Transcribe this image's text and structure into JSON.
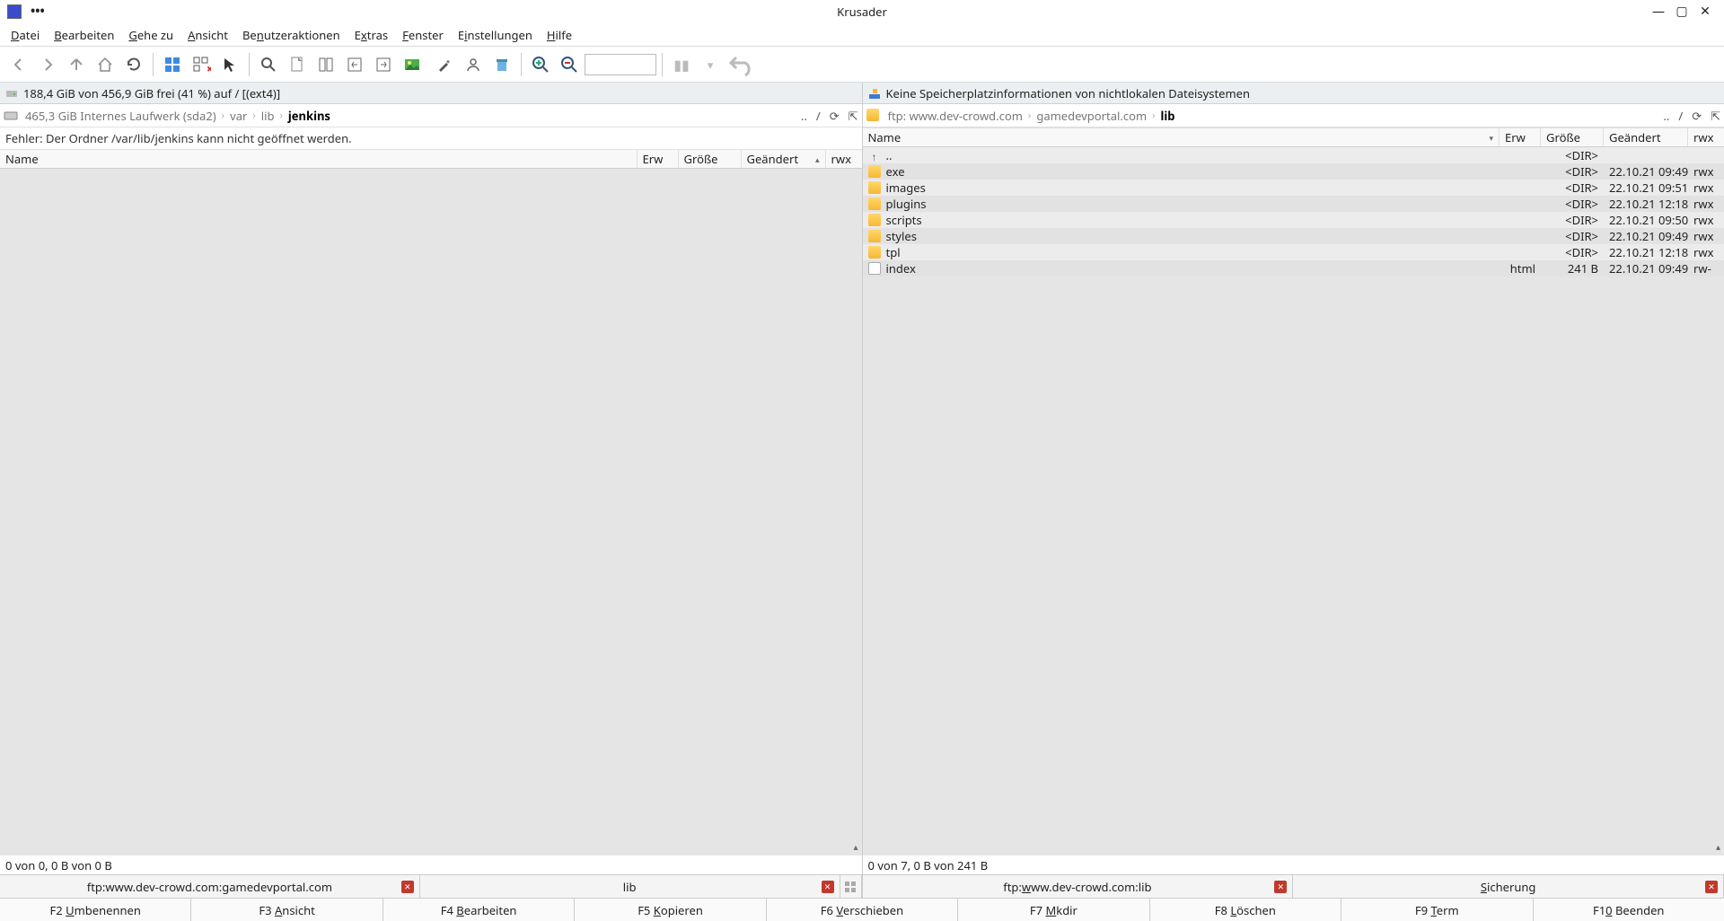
{
  "title": "Krusader",
  "menu": [
    "Datei",
    "Bearbeiten",
    "Gehe zu",
    "Ansicht",
    "Benutzeraktionen",
    "Extras",
    "Fenster",
    "Einstellungen",
    "Hilfe"
  ],
  "menu_ul": [
    0,
    0,
    0,
    0,
    2,
    1,
    0,
    1,
    0
  ],
  "left": {
    "disk": "188,4 GiB von 456,9 GiB frei (41 %) auf / [(ext4)]",
    "bc_prefix": "465,3 GiB Internes Laufwerk (sda2)",
    "bc": [
      "var",
      "lib",
      "jenkins"
    ],
    "error": "Fehler: Der Ordner /var/lib/jenkins kann nicht geöffnet werden.",
    "cols": {
      "name": "Name",
      "erw": "Erw",
      "groesse": "Größe",
      "geaendert": "Geändert",
      "rwx": "rwx"
    },
    "status": "0 von 0, 0 B von 0 B",
    "tabs": [
      {
        "label": "ftp:www.dev-crowd.com:gamedevportal.com",
        "ul": -1
      },
      {
        "label": "lib",
        "ul": -1
      }
    ]
  },
  "right": {
    "disk": "Keine Speicherplatzinformationen von nichtlokalen Dateisystemen",
    "bc_prefix": "ftp: www.dev-crowd.com",
    "bc": [
      "gamedevportal.com",
      "lib"
    ],
    "cols": {
      "name": "Name",
      "erw": "Erw",
      "groesse": "Größe",
      "geaendert": "Geändert",
      "rwx": "rwx"
    },
    "rows": [
      {
        "name": "..",
        "erw": "",
        "groesse": "<DIR>",
        "geaendert": "",
        "rwx": "",
        "type": "up"
      },
      {
        "name": "exe",
        "erw": "",
        "groesse": "<DIR>",
        "geaendert": "22.10.21 09:49",
        "rwx": "rwx",
        "type": "dir"
      },
      {
        "name": "images",
        "erw": "",
        "groesse": "<DIR>",
        "geaendert": "22.10.21 09:51",
        "rwx": "rwx",
        "type": "dir"
      },
      {
        "name": "plugins",
        "erw": "",
        "groesse": "<DIR>",
        "geaendert": "22.10.21 12:18",
        "rwx": "rwx",
        "type": "dir"
      },
      {
        "name": "scripts",
        "erw": "",
        "groesse": "<DIR>",
        "geaendert": "22.10.21 09:50",
        "rwx": "rwx",
        "type": "dir"
      },
      {
        "name": "styles",
        "erw": "",
        "groesse": "<DIR>",
        "geaendert": "22.10.21 09:49",
        "rwx": "rwx",
        "type": "dir"
      },
      {
        "name": "tpl",
        "erw": "",
        "groesse": "<DIR>",
        "geaendert": "22.10.21 12:18",
        "rwx": "rwx",
        "type": "dir"
      },
      {
        "name": "index",
        "erw": "html",
        "groesse": "241 B",
        "geaendert": "22.10.21 09:49",
        "rwx": "rw-",
        "type": "file"
      }
    ],
    "status": "0 von 7, 0 B von 241 B",
    "tabs": [
      {
        "label": "ftp:www.dev-crowd.com:lib",
        "ul": 4
      },
      {
        "label": "Sicherung",
        "ul": 0
      }
    ]
  },
  "fkeys": [
    {
      "t": "F2 Umbenennen",
      "u": 3
    },
    {
      "t": "F3 Ansicht",
      "u": 3
    },
    {
      "t": "F4 Bearbeiten",
      "u": 3
    },
    {
      "t": "F5 Kopieren",
      "u": 3
    },
    {
      "t": "F6 Verschieben",
      "u": 3
    },
    {
      "t": "F7 Mkdir",
      "u": 3
    },
    {
      "t": "F8 Löschen",
      "u": 3
    },
    {
      "t": "F9 Term",
      "u": 3
    },
    {
      "t": "F10 Beenden",
      "u": 2
    }
  ],
  "colw": {
    "left": {
      "name": 504,
      "erw": 42,
      "groesse": 66,
      "geaendert": 84,
      "rwx": 44
    },
    "right": {
      "name": 500,
      "erw": 42,
      "groesse": 66,
      "geaendert": 90,
      "rwx": 40
    }
  }
}
